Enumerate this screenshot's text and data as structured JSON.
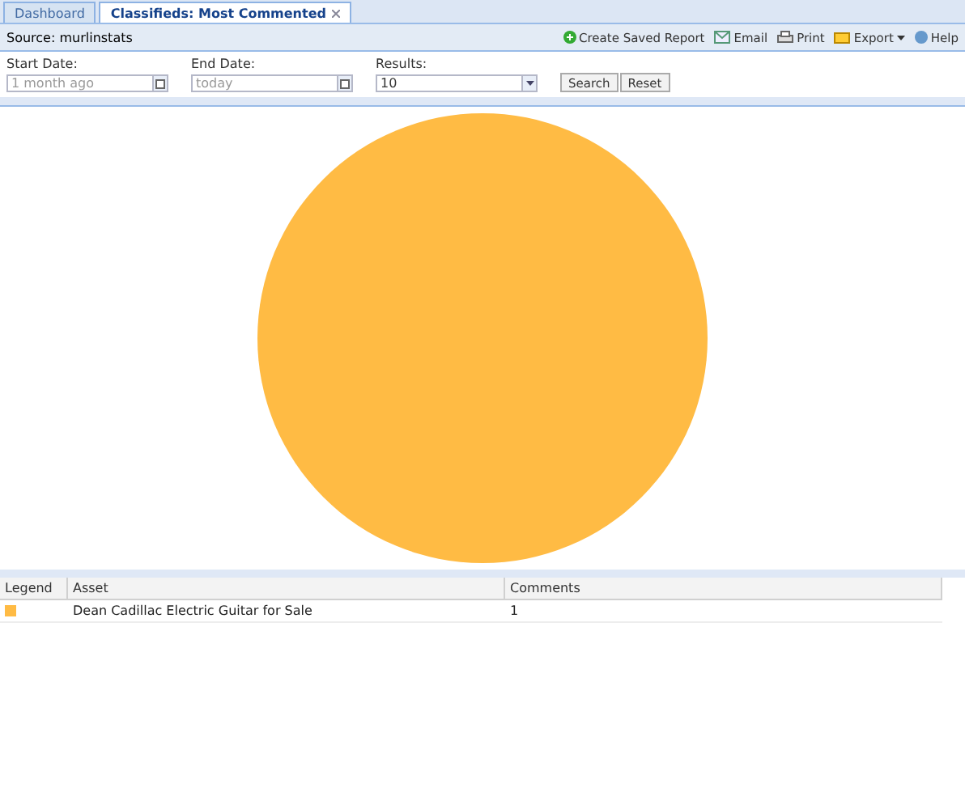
{
  "tabs": [
    {
      "label": "Dashboard",
      "selected": false,
      "closable": false
    },
    {
      "label": "Classifieds: Most Commented",
      "selected": true,
      "closable": true
    }
  ],
  "source": "Source: murlinstats",
  "toolbar": [
    {
      "label": "Create Saved Report",
      "kind": "plus"
    },
    {
      "label": "Email",
      "kind": "email"
    },
    {
      "label": "Print",
      "kind": "print"
    },
    {
      "label": "Export",
      "kind": "export",
      "menu": true
    },
    {
      "label": "Help",
      "kind": "help"
    }
  ],
  "filters": {
    "start_date": {
      "label": "Start Date:",
      "placeholder": "1 month ago"
    },
    "end_date": {
      "label": "End Date:",
      "placeholder": "today"
    },
    "results": {
      "label": "Results:",
      "value": "10"
    }
  },
  "buttons": [
    "Search",
    "Reset"
  ],
  "table": {
    "columns": [
      "Legend",
      "Asset",
      "Comments"
    ],
    "rows": [
      {
        "color": "#ffbb44",
        "asset": "Dean Cadillac Electric Guitar for Sale",
        "comments": "1"
      }
    ]
  }
}
